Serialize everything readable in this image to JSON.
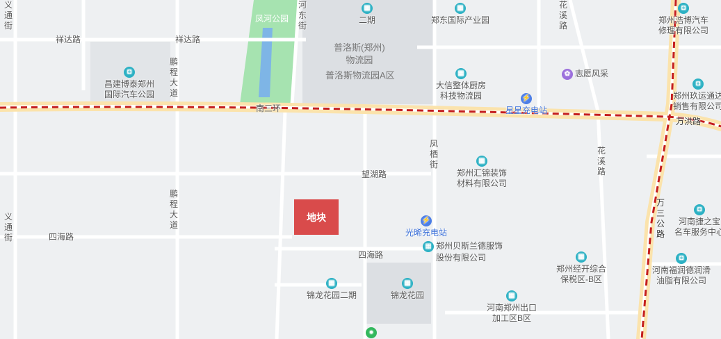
{
  "parcel_label": "地块",
  "roads": {
    "xiangda": "祥达路",
    "nansanhuan": "南三环",
    "wanghu": "望湖路",
    "sihai_west": "四海路",
    "sihai_east": "四海路",
    "wanhong": "万洪路",
    "pengcheng_north": "鹏程大道",
    "pengcheng_south": "鹏程大道",
    "fengqi": "凤栖街",
    "huaxi_north": "花溪路",
    "huaxi_south": "花溪路",
    "yitong_north": "义通街",
    "yitong_south": "义通街",
    "hedong": "河东街",
    "wangong": "万三公路"
  },
  "areas": {
    "fenghe_park": "凤河公园",
    "puluosi_1": "普洛斯(郑州)",
    "puluosi_2": "物流园",
    "puluosi_3": "普洛斯物流园A区"
  },
  "pois": {
    "erqi": "二期",
    "zhengdong": "郑东国际产业园",
    "changjian_1": "昌建博泰郑州",
    "changjian_2": "国际汽车公园",
    "daxin_1": "大信整体厨房",
    "daxin_2": "科技物流园",
    "zhiyuan": "志愿风采",
    "xingxing": "星星充电站",
    "haobo_1": "郑州浩博汽车",
    "haobo_2": "修理有限公司",
    "jiuyun_1": "郑州玖运通达",
    "jiuyun_2": "销售有限公司",
    "huijin_1": "郑州汇锦装饰",
    "huijin_2": "材料有限公司",
    "guangxi": "光晞充电站",
    "besi_1": "郑州贝斯兰德服饰",
    "besi_2": "股份有限公司",
    "jinlong2": "锦龙花园二期",
    "jinlong": "锦龙花园",
    "baoshui_1": "郑州经开综合",
    "baoshui_2": "保税区-B区",
    "chukou_1": "河南郑州出口",
    "chukou_2": "加工区B区",
    "jiezhibao_1": "河南捷之宝",
    "jiezhibao_2": "名车服务中心",
    "runhua_1": "河南福润德润滑",
    "runhua_2": "油脂有限公司"
  },
  "colors": {
    "background": "#eef0f2",
    "road": "#ffffff",
    "major_road": "#fbe3ac",
    "boundary": "#c41e1e",
    "park": "#a6e3b0",
    "water": "#7eb5e6",
    "parcel": "#d94b4b"
  }
}
